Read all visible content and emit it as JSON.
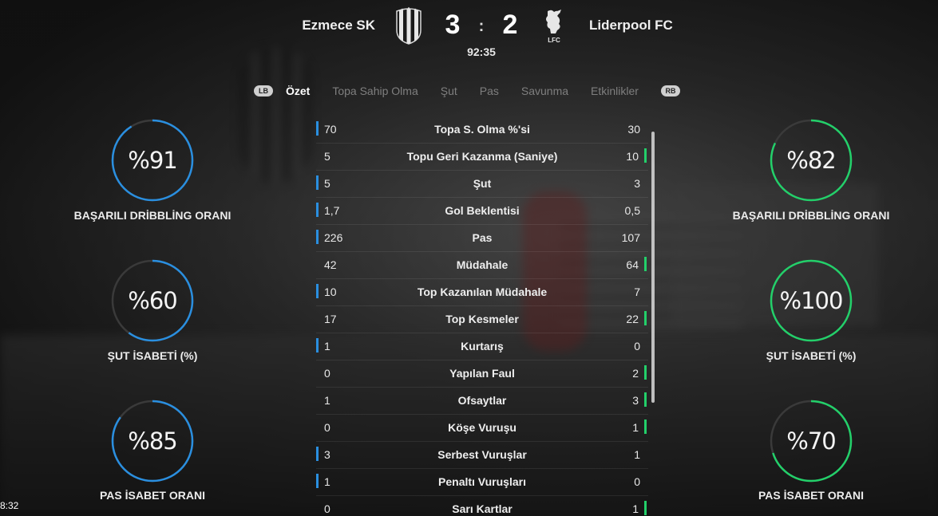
{
  "match": {
    "home_team": "Ezmece SK",
    "away_team": "Liderpool FC",
    "home_score": "3",
    "separator": ":",
    "away_score": "2",
    "clock": "92:35",
    "home_crest": "striped-shield-crest",
    "away_crest": "liverbird-crest",
    "away_crest_text": "LFC"
  },
  "tabs": {
    "left_bumper": "LB",
    "right_bumper": "RB",
    "items": [
      "Özet",
      "Topa Sahip Olma",
      "Şut",
      "Pas",
      "Savunma",
      "Etkinlikler"
    ],
    "active_index": 0
  },
  "home_rings": [
    {
      "value": "%91",
      "label": "BAŞARILI DRİBBLİNG ORANI",
      "fraction": 0.91
    },
    {
      "value": "%60",
      "label": "ŞUT İSABETİ (%)",
      "fraction": 0.6
    },
    {
      "value": "%85",
      "label": "PAS İSABET ORANI",
      "fraction": 0.85
    }
  ],
  "away_rings": [
    {
      "value": "%82",
      "label": "BAŞARILI DRİBBLİNG ORANI",
      "fraction": 0.82
    },
    {
      "value": "%100",
      "label": "ŞUT İSABETİ (%)",
      "fraction": 1.0
    },
    {
      "value": "%70",
      "label": "PAS İSABET ORANI",
      "fraction": 0.7
    }
  ],
  "stats": [
    {
      "name": "Topa S. Olma %'si",
      "home": "70",
      "away": "30",
      "leader": "home"
    },
    {
      "name": "Topu Geri Kazanma (Saniye)",
      "home": "5",
      "away": "10",
      "leader": "away"
    },
    {
      "name": "Şut",
      "home": "5",
      "away": "3",
      "leader": "home"
    },
    {
      "name": "Gol Beklentisi",
      "home": "1,7",
      "away": "0,5",
      "leader": "home"
    },
    {
      "name": "Pas",
      "home": "226",
      "away": "107",
      "leader": "home"
    },
    {
      "name": "Müdahale",
      "home": "42",
      "away": "64",
      "leader": "away"
    },
    {
      "name": "Top Kazanılan Müdahale",
      "home": "10",
      "away": "7",
      "leader": "home"
    },
    {
      "name": "Top Kesmeler",
      "home": "17",
      "away": "22",
      "leader": "away"
    },
    {
      "name": "Kurtarış",
      "home": "1",
      "away": "0",
      "leader": "home"
    },
    {
      "name": "Yapılan Faul",
      "home": "0",
      "away": "2",
      "leader": "away"
    },
    {
      "name": "Ofsaytlar",
      "home": "1",
      "away": "3",
      "leader": "away"
    },
    {
      "name": "Köşe Vuruşu",
      "home": "0",
      "away": "1",
      "leader": "away"
    },
    {
      "name": "Serbest Vuruşlar",
      "home": "3",
      "away": "1",
      "leader": "home"
    },
    {
      "name": "Penaltı Vuruşları",
      "home": "1",
      "away": "0",
      "leader": "home"
    },
    {
      "name": "Sarı Kartlar",
      "home": "0",
      "away": "1",
      "leader": "away"
    }
  ],
  "colors": {
    "home_accent": "#2a8fe0",
    "away_accent": "#23d06a",
    "ring_track": "#3a3a3a"
  },
  "corner_time": "8:32"
}
